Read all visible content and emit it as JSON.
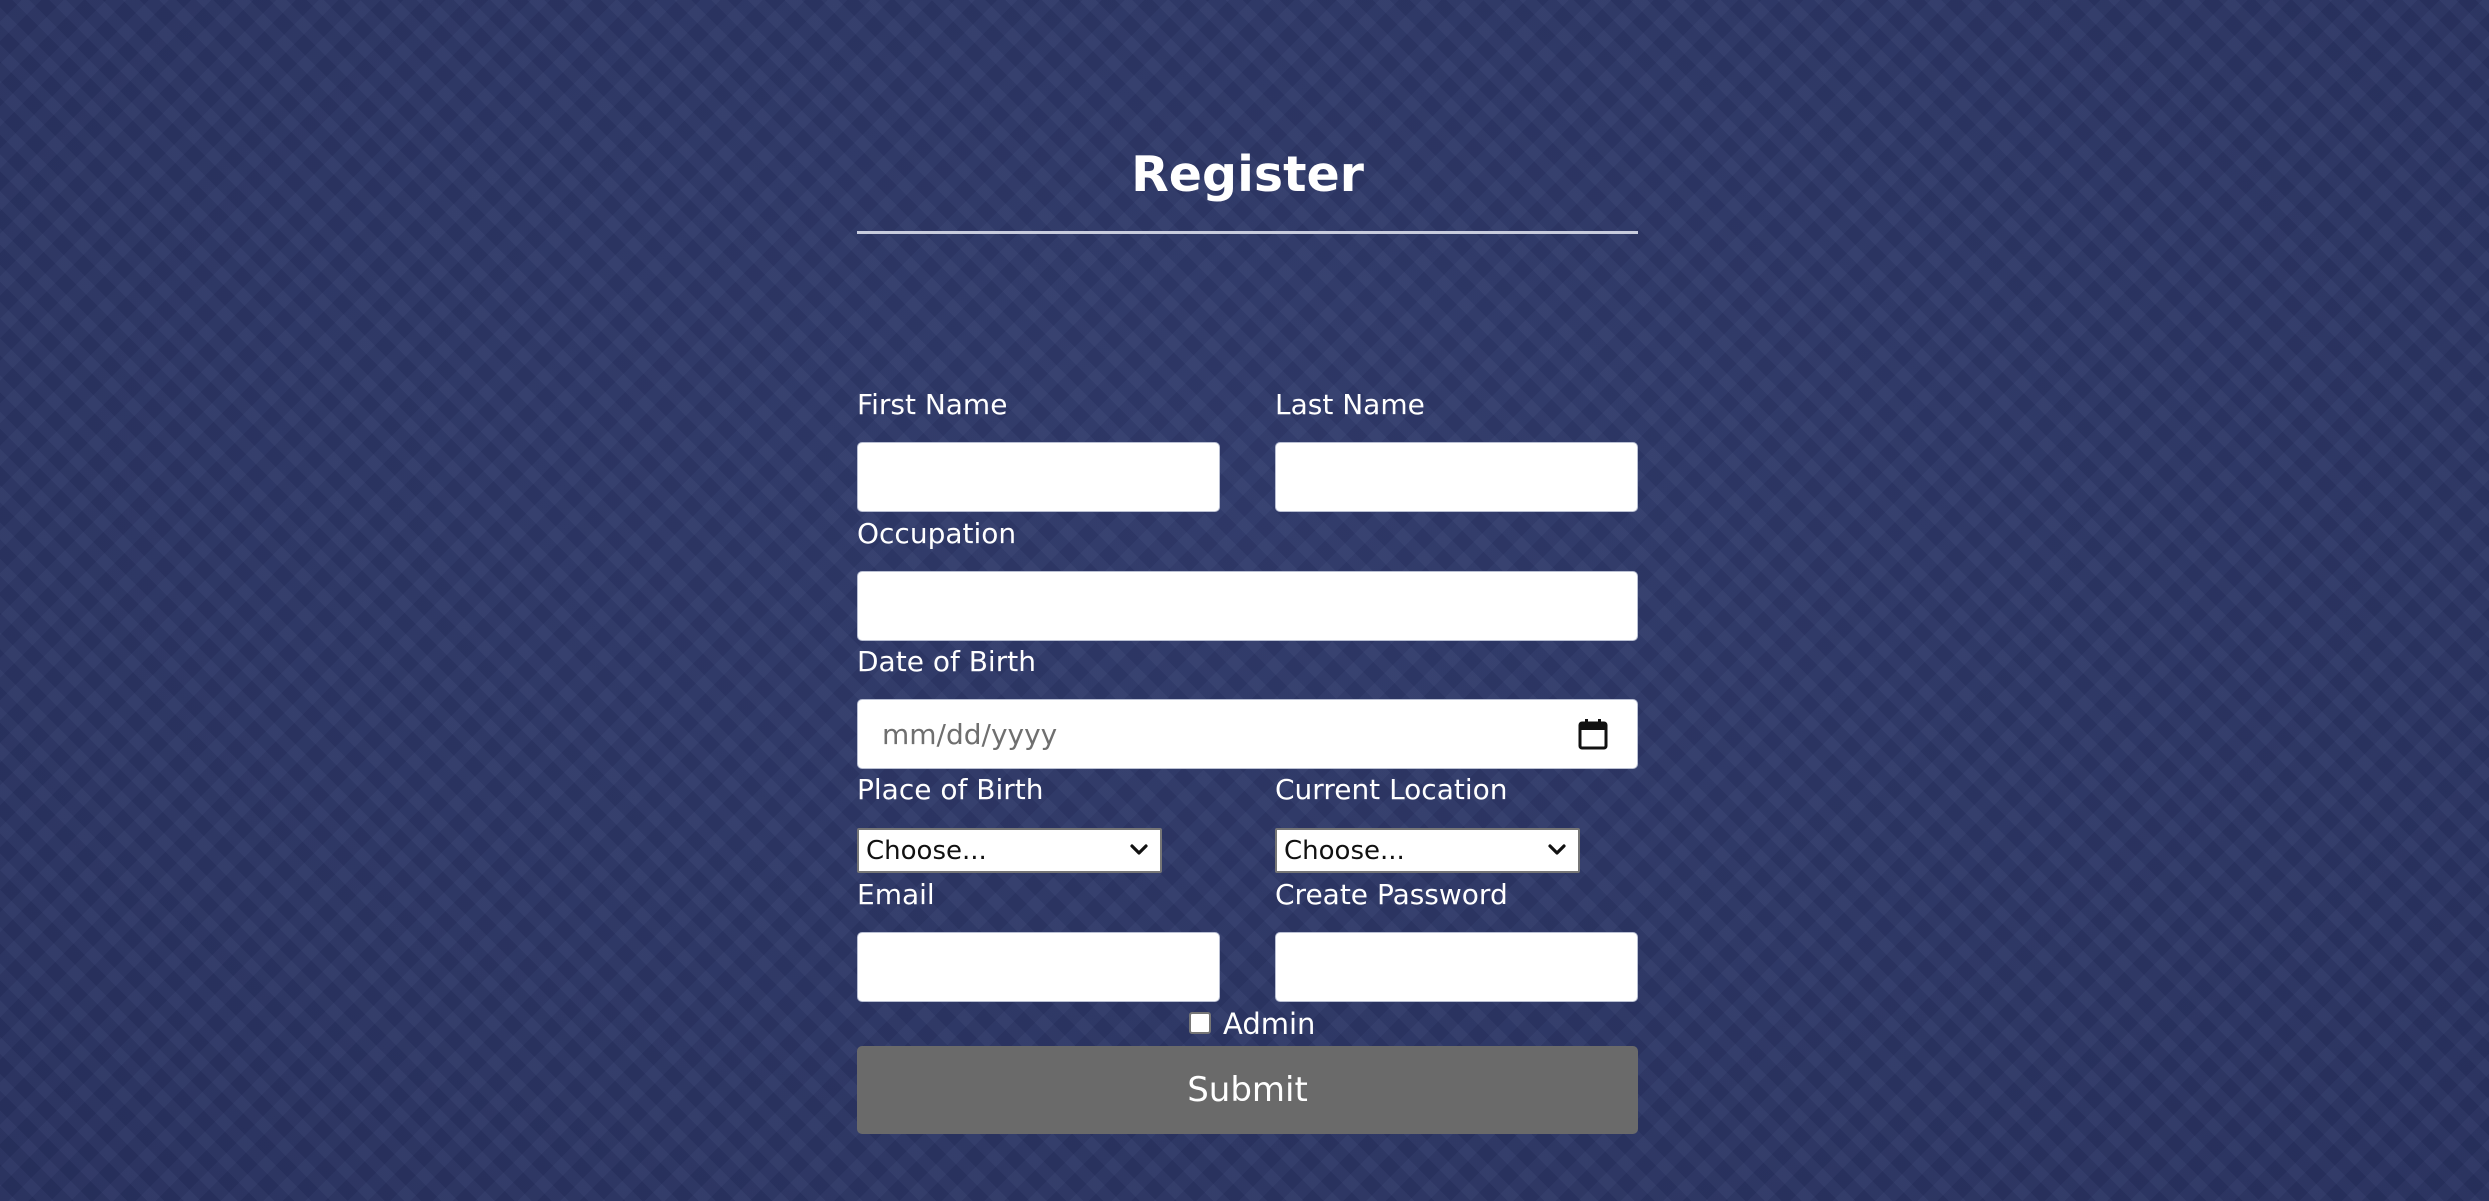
{
  "page": {
    "title": "Register"
  },
  "form": {
    "first_name": {
      "label": "First Name",
      "value": ""
    },
    "last_name": {
      "label": "Last Name",
      "value": ""
    },
    "occupation": {
      "label": "Occupation",
      "value": ""
    },
    "date_of_birth": {
      "label": "Date of Birth",
      "placeholder": "mm/dd/yyyy",
      "icon": "calendar-icon"
    },
    "place_of_birth": {
      "label": "Place of Birth",
      "selected": "Choose..."
    },
    "current_location": {
      "label": "Current Location",
      "selected": "Choose..."
    },
    "email": {
      "label": "Email",
      "value": ""
    },
    "create_password": {
      "label": "Create Password",
      "value": ""
    },
    "admin": {
      "label": "Admin",
      "checked": false
    },
    "submit_label": "Submit"
  },
  "colors": {
    "background": "#2c3766",
    "submit_button": "#6a6a6a",
    "text": "#ffffff"
  }
}
